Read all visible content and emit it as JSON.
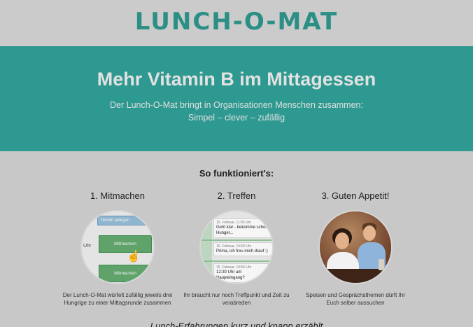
{
  "header": {
    "logo": "LUNCH-O-MAT"
  },
  "hero": {
    "title": "Mehr Vitamin B im Mittagessen",
    "subtitle_line1": "Der Lunch-O-Mat bringt in Organisationen Menschen zusammen:",
    "subtitle_line2": "Simpel – clever – zufällig"
  },
  "how": {
    "heading": "So funktioniert's:"
  },
  "steps": [
    {
      "title": "1. Mitmachen",
      "desc": "Der Lunch-O-Mat würfelt zufällig jeweils drei Hungrige zu einer Mittagsrunde zusammen",
      "mock": {
        "bar_label": "Termin anlegen",
        "uhr": "Uhr",
        "button1": "Mitmachen",
        "button2": "Mitmachen"
      }
    },
    {
      "title": "2. Treffen",
      "desc": "Ihr braucht nur noch Treffpunkt und Zeit zu verabreden",
      "mock": {
        "messages": [
          {
            "time": "15. Februar, 11:05 Uhr",
            "text": "Geht klar - bekomme schon Hunger..."
          },
          {
            "time": "15. Februar, 10:59 Uhr",
            "text": "Prima, ich freu mich drauf :)"
          },
          {
            "time": "15. Februar, 10:55 Uhr",
            "text": "12:30 Uhr am Haupteingang?"
          }
        ]
      }
    },
    {
      "title": "3. Guten Appetit!",
      "desc": "Speisen und Gesprächsthemen dürft Ihr Euch selber aussuchen"
    }
  ],
  "bottom": {
    "text": "Lunch-Erfahrungen kurz und knapp erzählt"
  },
  "colors": {
    "teal": "#2d9990",
    "logo": "#2b8f86",
    "button_green": "#5fa36a"
  }
}
